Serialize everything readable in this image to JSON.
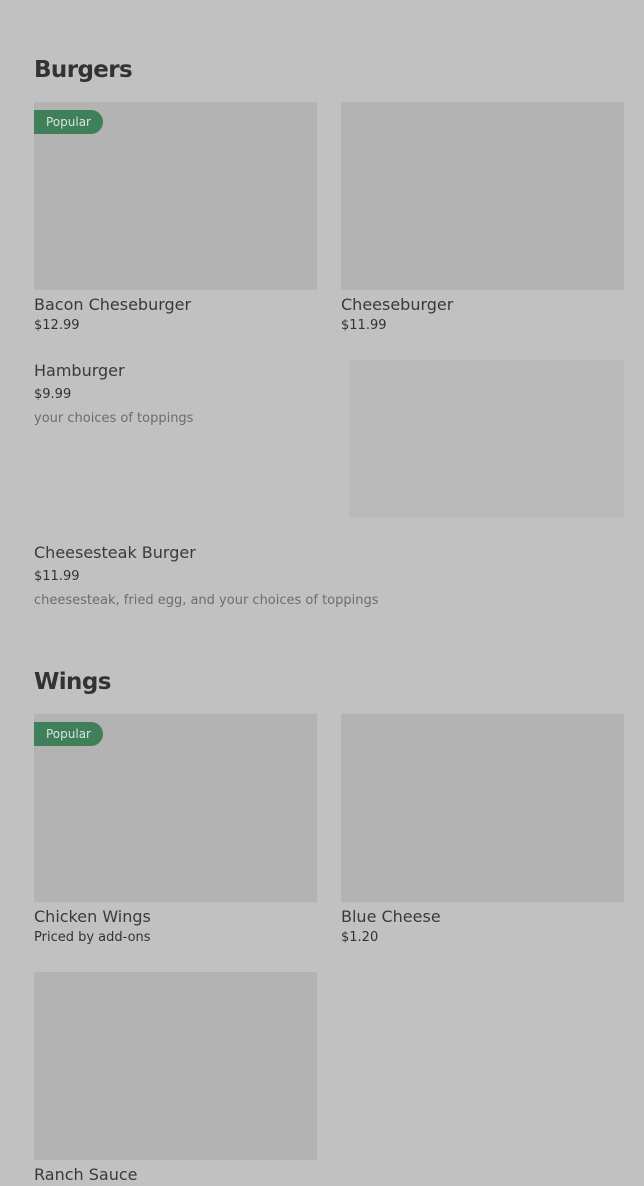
{
  "sections": [
    {
      "title": "Burgers",
      "items": [
        {
          "name": "Bacon Cheseburger",
          "price": "$12.99",
          "badge": "Popular"
        },
        {
          "name": "Cheeseburger",
          "price": "$11.99"
        },
        {
          "name": "Hamburger",
          "price": "$9.99",
          "description": "your choices of toppings"
        },
        {
          "name": "Cheesesteak Burger",
          "price": "$11.99",
          "description": "cheesesteak, fried egg, and your choices of toppings"
        }
      ]
    },
    {
      "title": "Wings",
      "items": [
        {
          "name": "Chicken Wings",
          "price": "Priced by add-ons",
          "badge": "Popular"
        },
        {
          "name": "Blue Cheese",
          "price": "$1.20"
        },
        {
          "name": "Ranch Sauce",
          "price": ""
        }
      ]
    }
  ],
  "colors": {
    "background": "#c1c1c1",
    "image_placeholder": "#b3b3b3",
    "badge": "#3f7f5a"
  }
}
